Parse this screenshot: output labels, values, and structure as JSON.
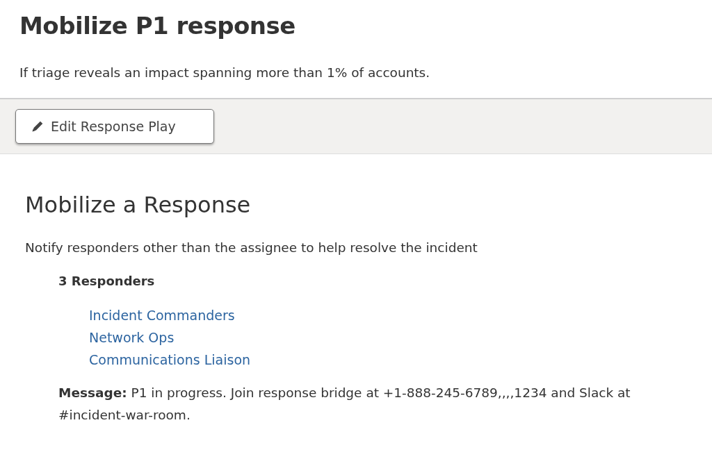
{
  "title": "Mobilize P1 response",
  "description": "If triage reveals an impact spanning more than 1% of accounts.",
  "toolbar": {
    "edit_button": "Edit Response Play"
  },
  "section": {
    "heading": "Mobilize a Response",
    "text": "Notify responders other than the assignee to help resolve the incident",
    "responders_label": "3 Responders",
    "responders": [
      "Incident Commanders",
      "Network Ops",
      "Communications Liaison"
    ],
    "message": "**Message:** P1 in progress. Join response bridge at +1-888-245-6789,,,,1234 and Slack at #incident-war-room."
  }
}
